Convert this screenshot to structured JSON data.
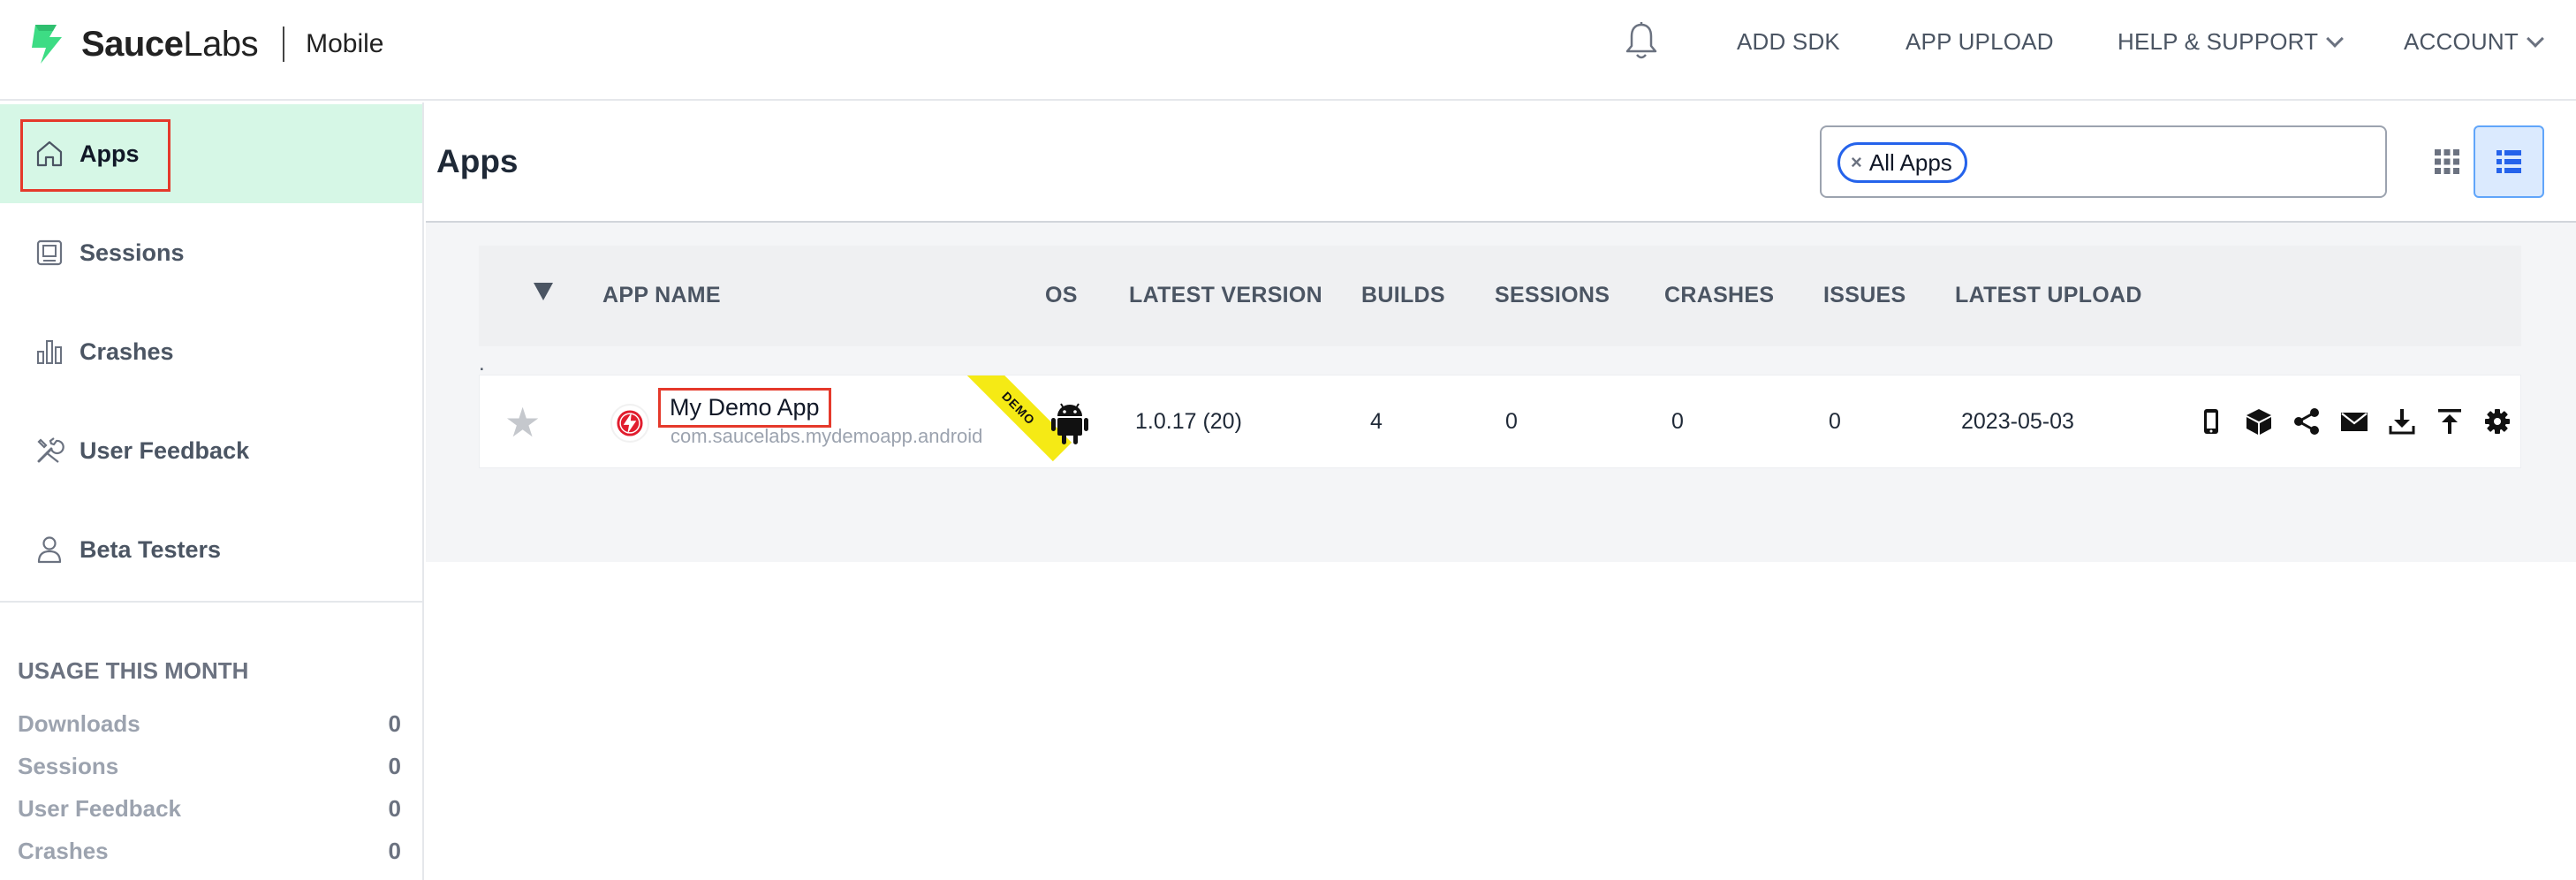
{
  "brand": {
    "name_bold": "Sauce",
    "name_rest": "Labs",
    "product": "Mobile",
    "accent": "#3ddc84"
  },
  "header": {
    "nav": [
      {
        "label": "ADD SDK"
      },
      {
        "label": "APP UPLOAD"
      },
      {
        "label": "HELP & SUPPORT"
      },
      {
        "label": "ACCOUNT"
      }
    ],
    "bell_icon": "bell-icon"
  },
  "sidebar": {
    "items": [
      {
        "label": "Apps",
        "icon": "home-icon",
        "active": true
      },
      {
        "label": "Sessions",
        "icon": "sessions-icon"
      },
      {
        "label": "Crashes",
        "icon": "bar-chart-icon"
      },
      {
        "label": "User Feedback",
        "icon": "tools-icon"
      },
      {
        "label": "Beta Testers",
        "icon": "person-icon"
      }
    ],
    "usage": {
      "title": "USAGE THIS MONTH",
      "rows": [
        {
          "label": "Downloads",
          "value": "0"
        },
        {
          "label": "Sessions",
          "value": "0"
        },
        {
          "label": "User Feedback",
          "value": "0"
        },
        {
          "label": "Crashes",
          "value": "0"
        }
      ]
    }
  },
  "main": {
    "title": "Apps",
    "filter": {
      "chip_label": "All Apps",
      "chip_remove": "×"
    },
    "table": {
      "columns": [
        "APP NAME",
        "OS",
        "LATEST VERSION",
        "BUILDS",
        "SESSIONS",
        "CRASHES",
        "ISSUES",
        "LATEST UPLOAD"
      ],
      "group_marker": ".",
      "rows": [
        {
          "name": "My Demo App",
          "package": "com.saucelabs.mydemoapp.android",
          "badge": "DEMO",
          "os": "android-icon",
          "latest_version": "1.0.17 (20)",
          "builds": "4",
          "sessions": "0",
          "crashes": "0",
          "issues": "0",
          "latest_upload": "2023-05-03"
        }
      ]
    },
    "row_actions": [
      "phone-icon",
      "package-icon",
      "share-icon",
      "mail-icon",
      "download-icon",
      "upload-icon",
      "gear-icon"
    ]
  }
}
